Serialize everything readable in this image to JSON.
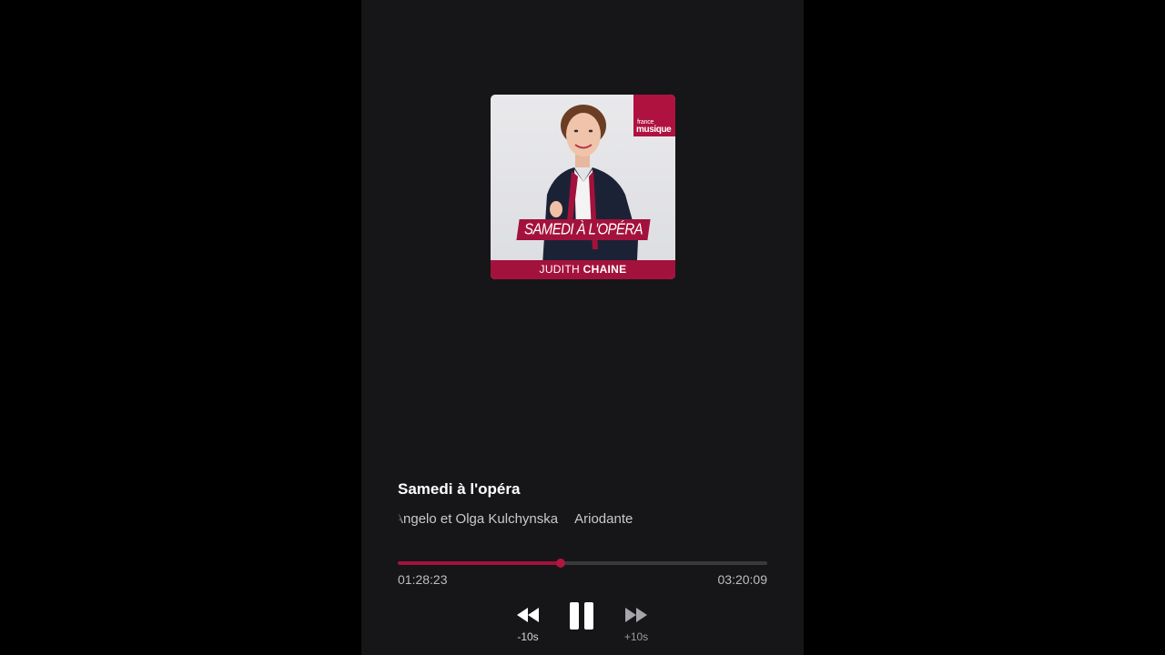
{
  "cover": {
    "brand_line1": "france",
    "brand_line2": "musique",
    "show_banner": "SAMEDI À L'OPÉRA",
    "host_first": "JUDITH",
    "host_last": "CHAINE"
  },
  "player": {
    "title": "Samedi à l'opéra",
    "subtitle_part1": "Angelo et Olga Kulchynska",
    "subtitle_part2": "Ariodante",
    "elapsed": "01:28:23",
    "total": "03:20:09",
    "progress_fraction": 0.44,
    "rewind_label": "-10s",
    "forward_label": "+10s"
  },
  "colors": {
    "accent": "#a3123c",
    "background": "#161518"
  },
  "icons": {
    "rewind": "rewind-icon",
    "pause": "pause-icon",
    "forward": "fast-forward-icon"
  }
}
